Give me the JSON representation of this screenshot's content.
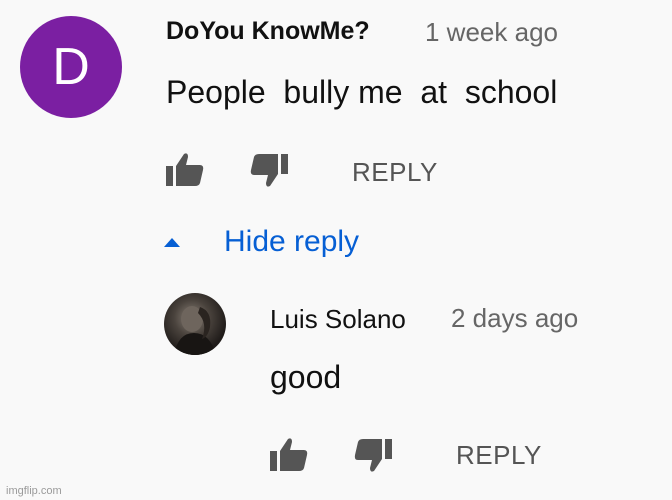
{
  "comment": {
    "avatar_letter": "D",
    "author": "DoYou KnowMe?",
    "timestamp": "1 week ago",
    "text": "People  bully me  at  school",
    "reply_label": "REPLY",
    "avatar_color": "#7b1fa2"
  },
  "replies_toggle": {
    "label": "Hide reply",
    "color": "#065fd4"
  },
  "reply": {
    "author": "Luis Solano",
    "timestamp": "2 days ago",
    "text": "good",
    "reply_label": "REPLY"
  },
  "watermark": "imgflip.com"
}
